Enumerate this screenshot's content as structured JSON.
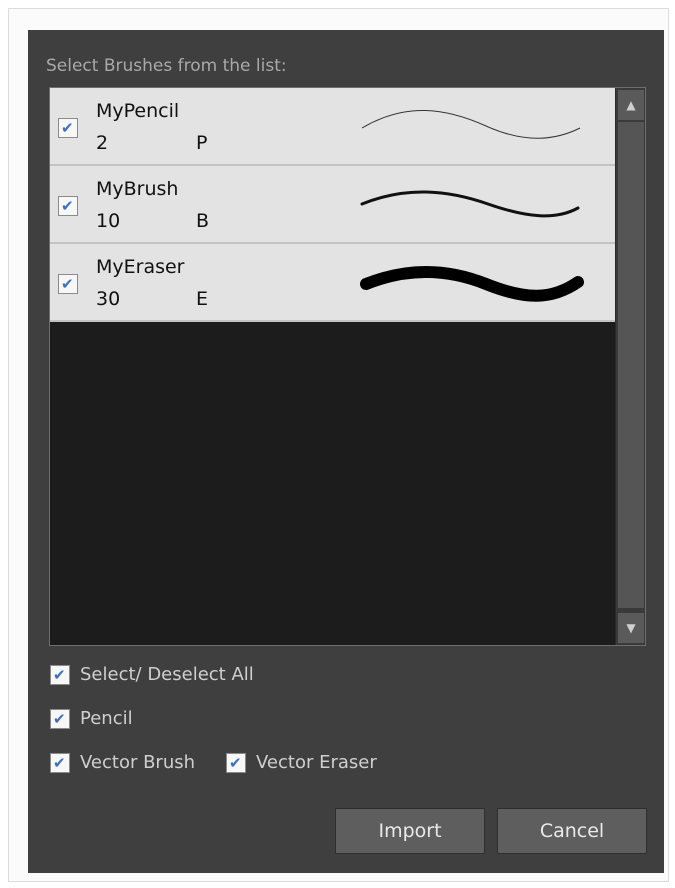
{
  "dialog": {
    "header_label": "Select Brushes from the list:"
  },
  "brushes": [
    {
      "name": "MyPencil",
      "size": "2",
      "shortcut": "P",
      "checked": true,
      "preview_icon": "thin-stroke-preview"
    },
    {
      "name": "MyBrush",
      "size": "10",
      "shortcut": "B",
      "checked": true,
      "preview_icon": "medium-stroke-preview"
    },
    {
      "name": "MyEraser",
      "size": "30",
      "shortcut": "E",
      "checked": true,
      "preview_icon": "thick-stroke-preview"
    }
  ],
  "options": {
    "select_all": {
      "label": "Select/ Deselect All",
      "checked": true
    },
    "pencil": {
      "label": "Pencil",
      "checked": true
    },
    "vector_brush": {
      "label": "Vector Brush",
      "checked": true
    },
    "vector_eraser": {
      "label": "Vector Eraser",
      "checked": true
    }
  },
  "buttons": {
    "import_label": "Import",
    "cancel_label": "Cancel"
  },
  "icons": {
    "check": "checkmark-icon",
    "scroll_up": "arrow-up-icon",
    "scroll_down": "arrow-down-icon"
  },
  "colors": {
    "dialog_bg": "#3f3f3f",
    "list_bg": "#1c1c1c",
    "row_bg": "#e3e3e3",
    "check_color": "#3b6fc0"
  }
}
